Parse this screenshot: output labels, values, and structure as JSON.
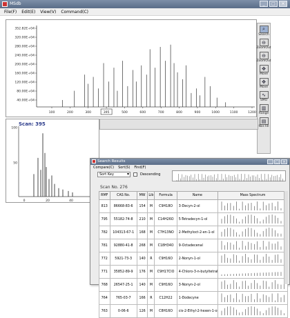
{
  "app": {
    "title": "MSdb"
  },
  "window_buttons": [
    "_",
    "□",
    "×"
  ],
  "menu": [
    "File(F)",
    "Edit(E)",
    "View(V)",
    "Command(C)"
  ],
  "main_chart": {
    "y_ticks": [
      "352.82E+04",
      "320.00E+04",
      "280.00E+04",
      "240.00E+04",
      "200.00E+04",
      "160.00E+04",
      "120.00E+04",
      "80.00E+04",
      "40.00E+04"
    ],
    "x_ticks": [
      "100",
      "200",
      "300",
      "395",
      "500",
      "600",
      "700",
      "800",
      "900",
      "1000",
      "1100",
      "1200"
    ],
    "selected_scan_label": "395"
  },
  "chart_data": {
    "type": "bar",
    "title": "",
    "xlabel": "",
    "ylabel": "",
    "xlim": [
      0,
      1270
    ],
    "ylim": [
      0,
      3528200
    ],
    "x": [
      150,
      220,
      280,
      300,
      330,
      360,
      390,
      420,
      450,
      470,
      500,
      530,
      560,
      580,
      610,
      640,
      660,
      690,
      720,
      750,
      780,
      800,
      820,
      850,
      870,
      900,
      930,
      950,
      980,
      1010,
      1050,
      1100
    ],
    "values": [
      300000,
      700000,
      1400000,
      1000000,
      1300000,
      800000,
      1900000,
      1100000,
      1700000,
      700000,
      2000000,
      900000,
      1600000,
      1100000,
      1800000,
      1400000,
      2500000,
      1700000,
      2600000,
      2000000,
      2700000,
      1900000,
      1500000,
      1200000,
      1800000,
      600000,
      800000,
      500000,
      1300000,
      900000,
      400000,
      200000
    ],
    "grid": false
  },
  "toolbar": [
    {
      "label": "Search",
      "icon": "search-icon"
    },
    {
      "label": "ZoomOut",
      "icon": "zoom-out-icon"
    },
    {
      "label": "ZoomOut",
      "icon": "zoom-out-icon"
    },
    {
      "label": "Move",
      "icon": "move-icon"
    },
    {
      "label": "Move",
      "icon": "move-icon"
    },
    {
      "label": "SMO",
      "icon": "smooth-icon"
    },
    {
      "label": "Range",
      "icon": "range-icon"
    },
    {
      "label": "Nor.Fill",
      "icon": "fill-icon"
    }
  ],
  "scan_panel": {
    "label": "Scan: 395",
    "y_ticks": [
      "100",
      "50"
    ],
    "x_ticks": [
      "0",
      "20",
      "40",
      "60"
    ]
  },
  "search_results": {
    "title": "Search Results",
    "menu": [
      "Compare(C)",
      "Sort(S)",
      "Find(F)"
    ],
    "sort_key": "Sort Key",
    "descending_label": "Descending",
    "scan_no": "Scan No. 276",
    "columns": [
      "RMF",
      "CAS No.",
      "MW",
      "Lib",
      "Formula",
      "Name",
      "Mass Spectrum"
    ],
    "rows": [
      [
        "813",
        "86668-83-6",
        "154",
        "M",
        "C9H18O",
        "3-Decyn-2-ol"
      ],
      [
        "795",
        "55182-74-8",
        "210",
        "M",
        "C14H26O",
        "5-Tetradecyn-1-ol"
      ],
      [
        "782",
        "104313-67-1",
        "168",
        "M",
        "C7H13NO",
        "2-Methyloct-2-en-1-ol"
      ],
      [
        "781",
        "92880-41-8",
        "268",
        "M",
        "C18H34O",
        "9-Octadecenal"
      ],
      [
        "772",
        "5921-73-3",
        "140",
        "R",
        "C9H16O",
        "2-Nonyn-1-ol"
      ],
      [
        "771",
        "35852-89-9",
        "176",
        "M",
        "C9H17ClO",
        "4-Chloro-3-n-butyltetrahydro"
      ],
      [
        "768",
        "26547-25-1",
        "140",
        "M",
        "C9H16O",
        "3-Nonyn-2-ol"
      ],
      [
        "764",
        "765-03-7",
        "166",
        "R",
        "C12H22",
        "1-Dodecyne"
      ],
      [
        "763",
        "0-06-6",
        "126",
        "M",
        "C8H16O",
        "cis-2-Ethyl-2-hexen-1-ol"
      ]
    ]
  }
}
